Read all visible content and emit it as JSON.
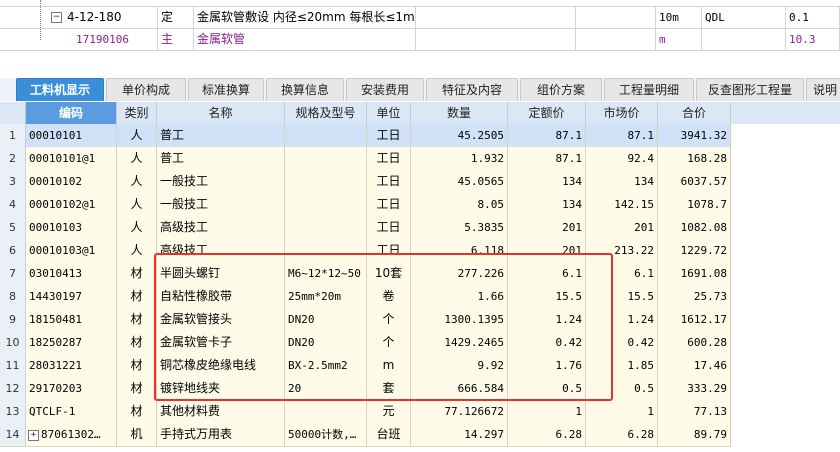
{
  "top_rows": [
    {
      "code": "4-12-180",
      "type": "定",
      "name": "金属软管敷设 内径≤20mm 每根长≤1m",
      "unit": "10m",
      "extra": "QDL",
      "val": "0.1"
    },
    {
      "code": "17190106",
      "type": "主",
      "name": "金属软管",
      "unit": "m",
      "extra": "",
      "val": "10.3"
    }
  ],
  "tabs": [
    "工料机显示",
    "单价构成",
    "标准换算",
    "换算信息",
    "安装费用",
    "特征及内容",
    "组价方案",
    "工程量明细",
    "反查图形工程量",
    "说明"
  ],
  "columns": [
    "编码",
    "类别",
    "名称",
    "规格及型号",
    "单位",
    "数量",
    "定额价",
    "市场价",
    "合价"
  ],
  "rows": [
    {
      "n": "1",
      "code": "00010101",
      "cat": "人",
      "name": "普工",
      "spec": "",
      "unit": "工日",
      "qty": "45.2505",
      "quota": "87.1",
      "market": "87.1",
      "total": "3941.32"
    },
    {
      "n": "2",
      "code": "00010101@1",
      "cat": "人",
      "name": "普工",
      "spec": "",
      "unit": "工日",
      "qty": "1.932",
      "quota": "87.1",
      "market": "92.4",
      "total": "168.28"
    },
    {
      "n": "3",
      "code": "00010102",
      "cat": "人",
      "name": "一般技工",
      "spec": "",
      "unit": "工日",
      "qty": "45.0565",
      "quota": "134",
      "market": "134",
      "total": "6037.57"
    },
    {
      "n": "4",
      "code": "00010102@1",
      "cat": "人",
      "name": "一般技工",
      "spec": "",
      "unit": "工日",
      "qty": "8.05",
      "quota": "134",
      "market": "142.15",
      "total": "1078.7"
    },
    {
      "n": "5",
      "code": "00010103",
      "cat": "人",
      "name": "高级技工",
      "spec": "",
      "unit": "工日",
      "qty": "5.3835",
      "quota": "201",
      "market": "201",
      "total": "1082.08"
    },
    {
      "n": "6",
      "code": "00010103@1",
      "cat": "人",
      "name": "高级技工",
      "spec": "",
      "unit": "工日",
      "qty": "6.118",
      "quota": "201",
      "market": "213.22",
      "total": "1229.72"
    },
    {
      "n": "7",
      "code": "03010413",
      "cat": "材",
      "name": "半圆头螺钉",
      "spec": "M6~12*12~50",
      "unit": "10套",
      "qty": "277.226",
      "quota": "6.1",
      "market": "6.1",
      "total": "1691.08"
    },
    {
      "n": "8",
      "code": "14430197",
      "cat": "材",
      "name": "自粘性橡胶带",
      "spec": "25mm*20m",
      "unit": "卷",
      "qty": "1.66",
      "quota": "15.5",
      "market": "15.5",
      "total": "25.73"
    },
    {
      "n": "9",
      "code": "18150481",
      "cat": "材",
      "name": "金属软管接头",
      "spec": "DN20",
      "unit": "个",
      "qty": "1300.1395",
      "quota": "1.24",
      "market": "1.24",
      "total": "1612.17"
    },
    {
      "n": "10",
      "code": "18250287",
      "cat": "材",
      "name": "金属软管卡子",
      "spec": "DN20",
      "unit": "个",
      "qty": "1429.2465",
      "quota": "0.42",
      "market": "0.42",
      "total": "600.28"
    },
    {
      "n": "11",
      "code": "28031221",
      "cat": "材",
      "name": "铜芯橡皮绝缘电线",
      "spec": "BX-2.5mm2",
      "unit": "m",
      "qty": "9.92",
      "quota": "1.76",
      "market": "1.85",
      "total": "17.46"
    },
    {
      "n": "12",
      "code": "29170203",
      "cat": "材",
      "name": "镀锌地线夹",
      "spec": "20",
      "unit": "套",
      "qty": "666.584",
      "quota": "0.5",
      "market": "0.5",
      "total": "333.29"
    },
    {
      "n": "13",
      "code": "QTCLF-1",
      "cat": "材",
      "name": "其他材料费",
      "spec": "",
      "unit": "元",
      "qty": "77.126672",
      "quota": "1",
      "market": "1",
      "total": "77.13"
    },
    {
      "n": "14",
      "code": "87061302…",
      "cat": "机",
      "name": "手持式万用表",
      "spec": "50000计数,…",
      "unit": "台班",
      "qty": "14.297",
      "quota": "6.28",
      "market": "6.28",
      "total": "89.79"
    }
  ],
  "colors": {
    "accent": "#3b8fd9",
    "highlight": "#e8312f",
    "row_bg": "#fffbe9",
    "selected_row": "#cfe2f7"
  }
}
